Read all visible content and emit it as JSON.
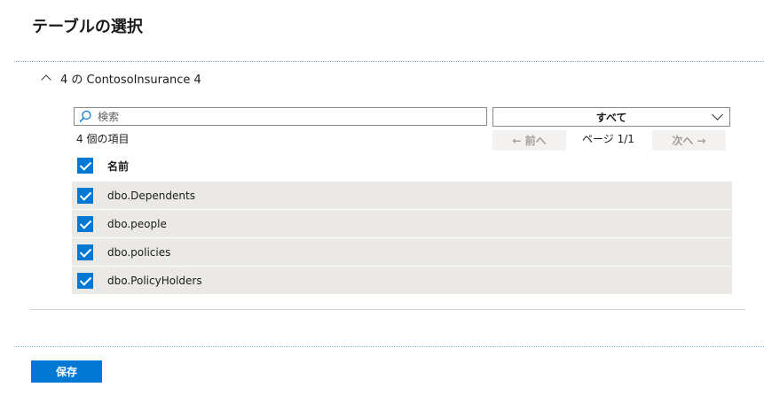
{
  "page": {
    "title": "テーブルの選択"
  },
  "section": {
    "title": "4 の ContosoInsurance 4",
    "collapse_icon": "chevron-up-icon"
  },
  "search": {
    "placeholder": "検索",
    "icon": "search-icon"
  },
  "filter": {
    "selected": "すべて",
    "icon": "chevron-down-icon"
  },
  "list": {
    "count_text": "4 個の項目",
    "column_header": "名前",
    "header_checked": true,
    "items": [
      {
        "label": "dbo.Dependents",
        "checked": true
      },
      {
        "label": "dbo.people",
        "checked": true
      },
      {
        "label": "dbo.policies",
        "checked": true
      },
      {
        "label": "dbo.PolicyHolders",
        "checked": true
      }
    ]
  },
  "pager": {
    "prev_label": "← 前へ",
    "page_text": "ページ 1/1",
    "next_label": "次へ →"
  },
  "footer": {
    "save_label": "保存"
  },
  "colors": {
    "accent": "#0078d4",
    "row_bg": "#ebe9e6",
    "disabled_bg": "#f3f2f1"
  }
}
